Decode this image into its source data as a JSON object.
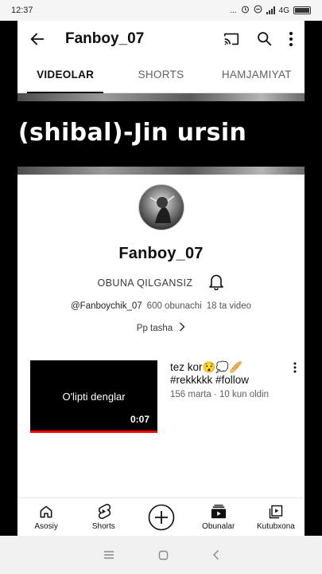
{
  "status_bar": {
    "time": "12:37",
    "dots": "...",
    "network": "4G"
  },
  "header": {
    "title": "Fanboy_07"
  },
  "tabs": [
    {
      "label": "VIDEOLAR",
      "active": true
    },
    {
      "label": "SHORTS",
      "active": false
    },
    {
      "label": "HAMJAMIYAT",
      "active": false
    }
  ],
  "banner": {
    "text": "-(shibal)-Jin ursin"
  },
  "channel": {
    "name": "Fanboy_07",
    "subscribe_label": "OBUNA QILGANSIZ",
    "handle": "@Fanboychik_07",
    "subscribers": "600 obunachi",
    "video_count": "18 ta video",
    "description": "Pp tasha"
  },
  "video": {
    "thumbnail_text": "O'lipti denglar",
    "duration": "0:07",
    "title": "tez kor😯💭🥖",
    "title_line2": "#rekkkkk #follow",
    "views_age": "156 marta · 10 kun oldin",
    "watch_progress": 1.0
  },
  "bottom_nav": [
    {
      "label": "Asosiy",
      "icon": "home-icon"
    },
    {
      "label": "Shorts",
      "icon": "shorts-icon"
    },
    {
      "label": "",
      "icon": "create-icon"
    },
    {
      "label": "Obunalar",
      "icon": "subscriptions-icon"
    },
    {
      "label": "Kutubxona",
      "icon": "library-icon"
    }
  ],
  "colors": {
    "accent": "#ff0000",
    "text": "#0f0f0f",
    "secondary": "#606060"
  }
}
